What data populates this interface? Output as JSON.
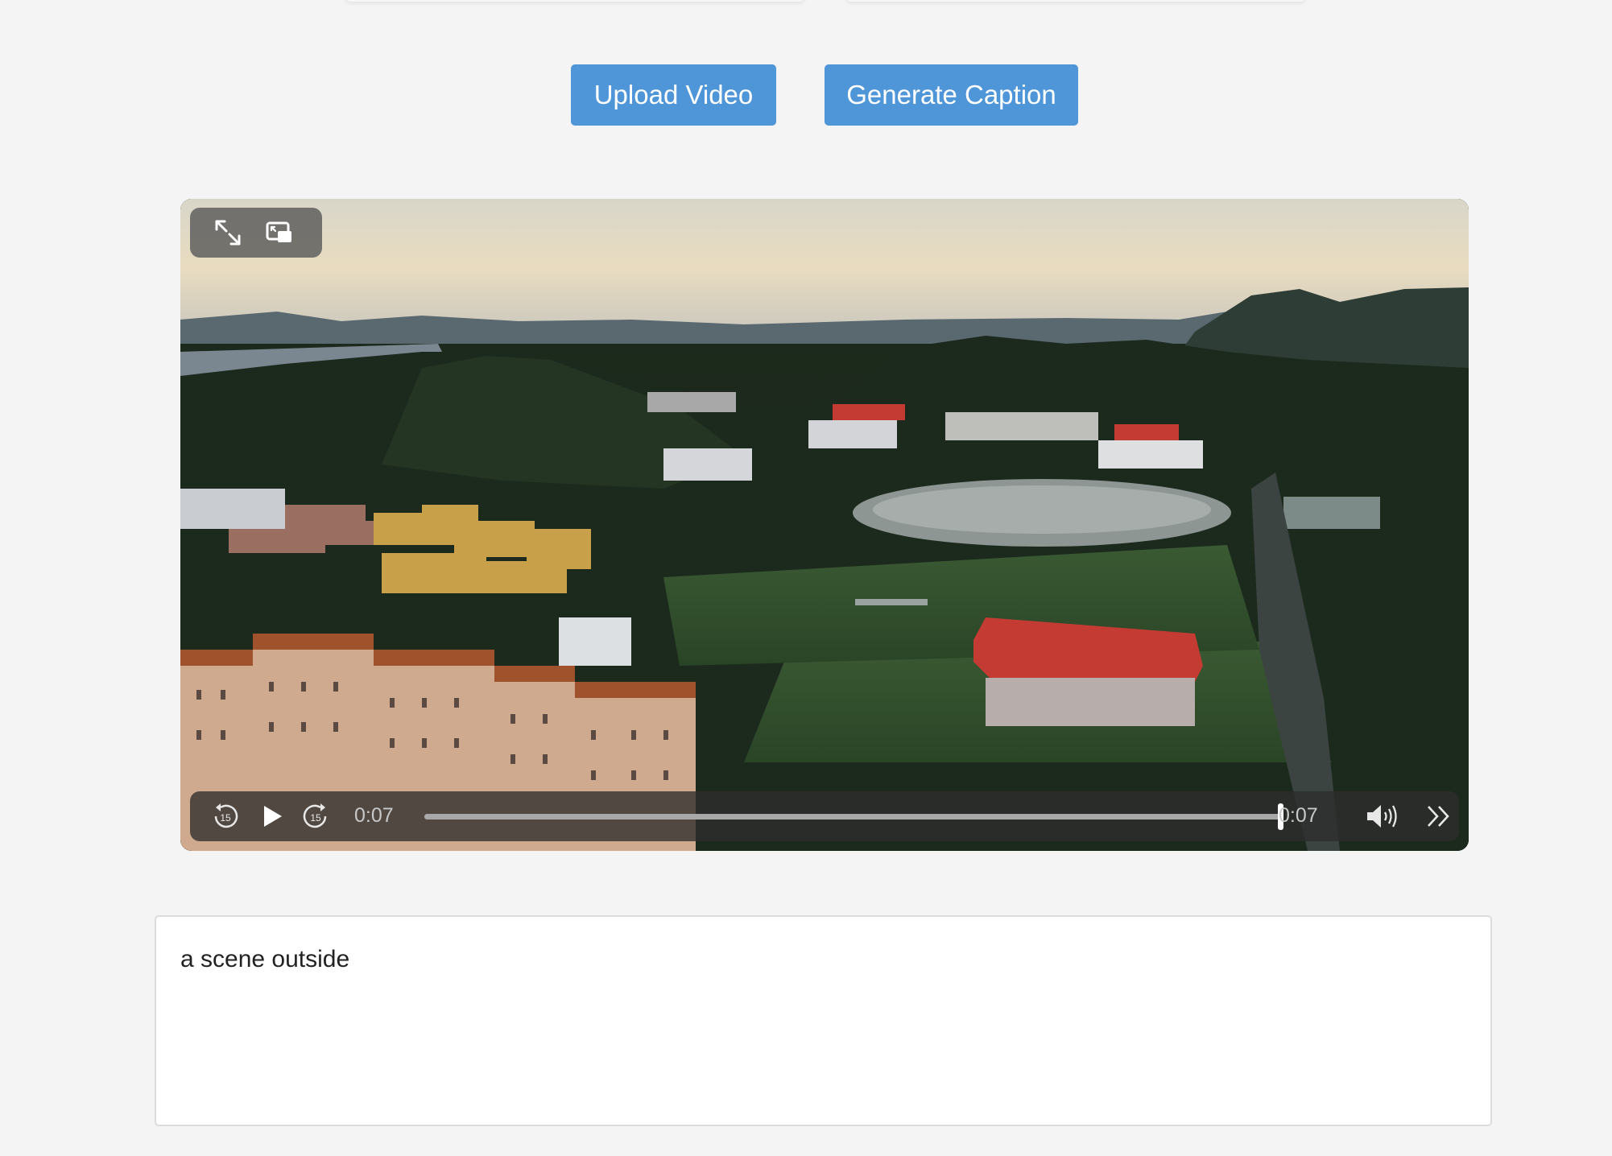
{
  "toolbar": {
    "upload_label": "Upload Video",
    "generate_label": "Generate Caption"
  },
  "video": {
    "top_controls": {
      "fullscreen_icon": "fullscreen-icon",
      "pip_icon": "picture-in-picture-icon"
    },
    "controls": {
      "skip_back_icon": "skip-back-15-icon",
      "skip_back_label": "15",
      "play_icon": "play-icon",
      "skip_forward_icon": "skip-forward-15-icon",
      "skip_forward_label": "15",
      "current_time": "0:07",
      "duration": "0:07",
      "progress": 1.0,
      "volume_icon": "volume-icon",
      "more_icon": "chevron-double-right-icon"
    }
  },
  "caption": {
    "text": "a scene outside"
  },
  "colors": {
    "page_background": "#f4f4f4",
    "button": "#4f96d8",
    "button_text": "#ffffff"
  }
}
